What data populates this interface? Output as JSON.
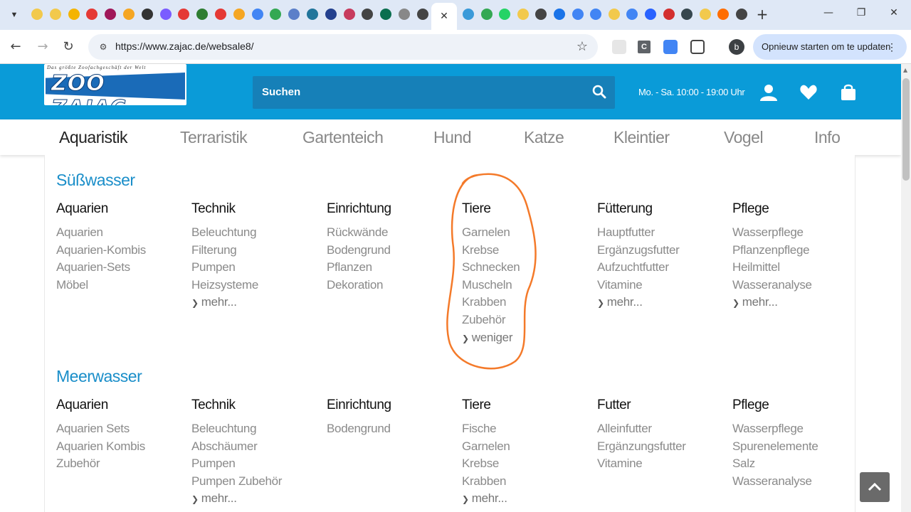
{
  "browser": {
    "active_tab_close": "✕",
    "new_tab": "+",
    "url": "https://www.zajac.de/websale8/",
    "update_button": "Opnieuw starten om te updaten",
    "ext_c_label": "C",
    "profile_initial": "b"
  },
  "header": {
    "logo_tagline": "Das größte Zoofachgeschäft der Welt",
    "logo_text": "ZOO ZAJAC",
    "search_label": "Suchen",
    "hours": "Mo. - Sa. 10:00 - 19:00 Uhr"
  },
  "nav": {
    "items": [
      "Aquaristik",
      "Terraristik",
      "Gartenteich",
      "Hund",
      "Katze",
      "Kleintier",
      "Vogel",
      "Info"
    ]
  },
  "sections": [
    {
      "title": "Süßwasser",
      "columns": [
        {
          "head": "Aquarien",
          "links": [
            "Aquarien",
            "Aquarien-Kombis",
            "Aquarien-Sets",
            "Möbel"
          ],
          "more": ""
        },
        {
          "head": "Technik",
          "links": [
            "Beleuchtung",
            "Filterung",
            "Pumpen",
            "Heizsysteme"
          ],
          "more": "mehr..."
        },
        {
          "head": "Einrichtung",
          "links": [
            "Rückwände",
            "Bodengrund",
            "Pflanzen",
            "Dekoration"
          ],
          "more": ""
        },
        {
          "head": "Tiere",
          "links": [
            "Garnelen",
            "Krebse",
            "Schnecken",
            "Muscheln",
            "Krabben",
            "Zubehör"
          ],
          "more": "weniger"
        },
        {
          "head": "Fütterung",
          "links": [
            "Hauptfutter",
            "Ergänzugsfutter",
            "Aufzuchtfutter",
            "Vitamine"
          ],
          "more": "mehr..."
        },
        {
          "head": "Pflege",
          "links": [
            "Wasserpflege",
            "Pflanzenpflege",
            "Heilmittel",
            "Wasseranalyse"
          ],
          "more": "mehr..."
        }
      ]
    },
    {
      "title": "Meerwasser",
      "columns": [
        {
          "head": "Aquarien",
          "links": [
            "Aquarien Sets",
            "Aquarien Kombis",
            "Zubehör"
          ],
          "more": ""
        },
        {
          "head": "Technik",
          "links": [
            "Beleuchtung",
            "Abschäumer",
            "Pumpen",
            "Pumpen Zubehör"
          ],
          "more": "mehr..."
        },
        {
          "head": "Einrichtung",
          "links": [
            "Bodengrund"
          ],
          "more": ""
        },
        {
          "head": "Tiere",
          "links": [
            "Fische",
            "Garnelen",
            "Krebse",
            "Krabben"
          ],
          "more": "mehr..."
        },
        {
          "head": "Futter",
          "links": [
            "Alleinfutter",
            "Ergänzungsfutter",
            "Vitamine"
          ],
          "more": ""
        },
        {
          "head": "Pflege",
          "links": [
            "Wasserpflege",
            "Spurenelemente",
            "Salz",
            "Wasseranalyse"
          ],
          "more": ""
        }
      ]
    }
  ],
  "colors": {
    "brand_blue": "#0a9bd8",
    "search_blue": "#1680b8",
    "section_title": "#1a8ec9",
    "annotation": "#f47a2a"
  }
}
